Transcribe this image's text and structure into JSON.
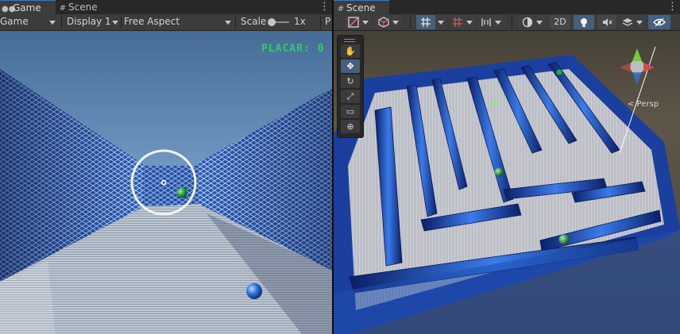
{
  "game": {
    "tab": {
      "label": "Game",
      "icon": "gamepad-icon"
    },
    "other_tab": {
      "label": "Scene",
      "icon": "grid-icon"
    },
    "toolbar": {
      "mode": "Game",
      "display": "Display 1",
      "aspect": "Free Aspect",
      "scale_label": "Scale",
      "scale_value": "1x",
      "scale_level": 0.1,
      "cut_label": "P"
    },
    "hud": {
      "score_text": "PLACAR: 0",
      "score_color": "#35c86a"
    }
  },
  "scene": {
    "tab": {
      "label": "Scene",
      "icon": "grid-icon"
    },
    "toolbar": {
      "two_d_label": "2D",
      "icons": [
        "draw-mode-icon",
        "shading-icon",
        "grid-snap-icon",
        "snap-increment-icon",
        "align-icon",
        "lighting-icon",
        "visibility-icon"
      ]
    },
    "tools": [
      "hand-tool-icon",
      "move-tool-icon",
      "rotate-tool-icon",
      "scale-tool-icon",
      "rect-tool-icon",
      "transform-tool-icon"
    ],
    "active_tool": "move-tool-icon",
    "gizmo_label": "< Persp"
  },
  "colors": {
    "accent": "#3a79bb",
    "sky_top": "#456c96",
    "sky_bottom": "#b8d5f0",
    "wall_blue": "#1f4fa8",
    "floor": "#a9b4c2",
    "scene_bg": "#5e5748",
    "green_ball": "#2aa83f",
    "blue_ball": "#2b6fd6"
  }
}
